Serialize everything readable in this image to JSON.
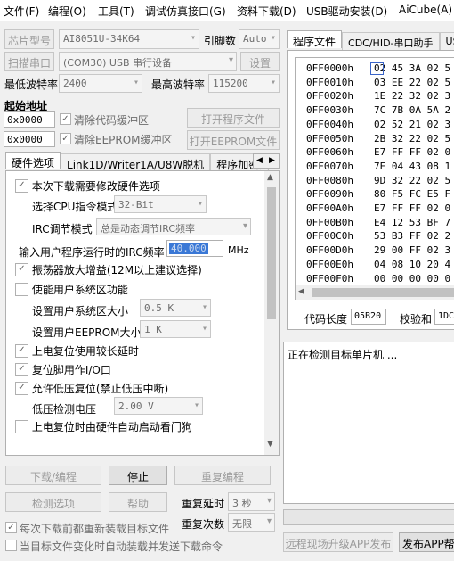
{
  "menu": [
    "文件(F)",
    "编程(O)",
    "工具(T)",
    "调试仿真接口(G)",
    "资料下载(D)",
    "USB驱动安装(D)",
    "AiCube(A)"
  ],
  "top": {
    "chip_label": "芯片型号",
    "chip_value": "AI8051U-34K64",
    "pins_label": "引脚数",
    "pins_value": "Auto",
    "scan_label": "扫描串口",
    "port_value": "(COM30) USB 串行设备",
    "settings_label": "设置",
    "min_baud_label": "最低波特率",
    "min_baud_value": "2400",
    "max_baud_label": "最高波特率",
    "max_baud_value": "115200",
    "start_addr_label": "起始地址",
    "addr1": "0x0000",
    "clear_code_label": "清除代码缓冲区",
    "open_program_label": "打开程序文件",
    "addr2": "0x0000",
    "clear_eeprom_label": "清除EEPROM缓冲区",
    "open_eeprom_label": "打开EEPROM文件"
  },
  "left_tabs": [
    "硬件选项",
    "Link1D/Writer1A/U8W脱机",
    "程序加密后"
  ],
  "hw": {
    "modify_hw": "本次下载需要修改硬件选项",
    "cpu_mode_label": "选择CPU指令模式",
    "cpu_mode_value": "32-Bit",
    "irc_mode_label": "IRC调节模式",
    "irc_mode_value": "总是动态调节IRC频率",
    "irc_freq_label": "输入用户程序运行时的IRC频率",
    "irc_freq_value": "40.000",
    "irc_freq_unit": "MHz",
    "osc_gain": "振荡器放大增益(12M以上建议选择)",
    "user_sys": "使能用户系统区功能",
    "user_sys_size_label": "设置用户系统区大小",
    "user_sys_size_value": "0.5 K",
    "user_eeprom_label": "设置用户EEPROM大小",
    "user_eeprom_value": "1 K",
    "long_delay": "上电复位使用较长延时",
    "reset_pin": "复位脚用作I/O口",
    "low_volt_reset": "允许低压复位(禁止低压中断)",
    "low_volt_label": "低压检测电压",
    "low_volt_value": "2.00 V",
    "watchdog": "上电复位时由硬件自动启动看门狗"
  },
  "bottom": {
    "download": "下载/编程",
    "stop": "停止",
    "reprogram": "重复编程",
    "detect": "检测选项",
    "help": "帮助",
    "repeat_delay_label": "重复延时",
    "repeat_delay_value": "3 秒",
    "repeat_count_label": "重复次数",
    "repeat_count_value": "无限",
    "reload_each": "每次下载前都重新装载目标文件",
    "auto_send": "当目标文件变化时自动装载并发送下载命令"
  },
  "right_tabs": [
    "程序文件",
    "CDC/HID-串口助手",
    "USB"
  ],
  "hex": [
    {
      "addr": "0FF0000h",
      "bytes": "02 45 3A 02 5"
    },
    {
      "addr": "0FF0010h",
      "bytes": "03 EE 22 02 5"
    },
    {
      "addr": "0FF0020h",
      "bytes": "1E 22 32 02 3"
    },
    {
      "addr": "0FF0030h",
      "bytes": "7C 7B 0A 5A 2"
    },
    {
      "addr": "0FF0040h",
      "bytes": "02 52 21 02 3"
    },
    {
      "addr": "0FF0050h",
      "bytes": "2B 32 22 02 5"
    },
    {
      "addr": "0FF0060h",
      "bytes": "E7 FF FF 02 0"
    },
    {
      "addr": "0FF0070h",
      "bytes": "7E 04 43 08 1"
    },
    {
      "addr": "0FF0080h",
      "bytes": "9D 32 22 02 5"
    },
    {
      "addr": "0FF0090h",
      "bytes": "80 F5 FC E5 F"
    },
    {
      "addr": "0FF00A0h",
      "bytes": "E7 FF FF 02 0"
    },
    {
      "addr": "0FF00B0h",
      "bytes": "E4 12 53 BF 7"
    },
    {
      "addr": "0FF00C0h",
      "bytes": "53 B3 FF 02 2"
    },
    {
      "addr": "0FF00D0h",
      "bytes": "29 00 FF 02 3"
    },
    {
      "addr": "0FF00E0h",
      "bytes": "04 08 10 20 4"
    },
    {
      "addr": "0FF00F0h",
      "bytes": "00 00 00 00 0"
    }
  ],
  "code_len_label": "代码长度",
  "code_len_value": "05B20",
  "checksum_label": "校验和",
  "checksum_value": "1DC",
  "log_text": "正在检测目标单片机 ...",
  "remote_upgrade": "远程现场升级APP发布",
  "publish_app": "发布APP帮助"
}
